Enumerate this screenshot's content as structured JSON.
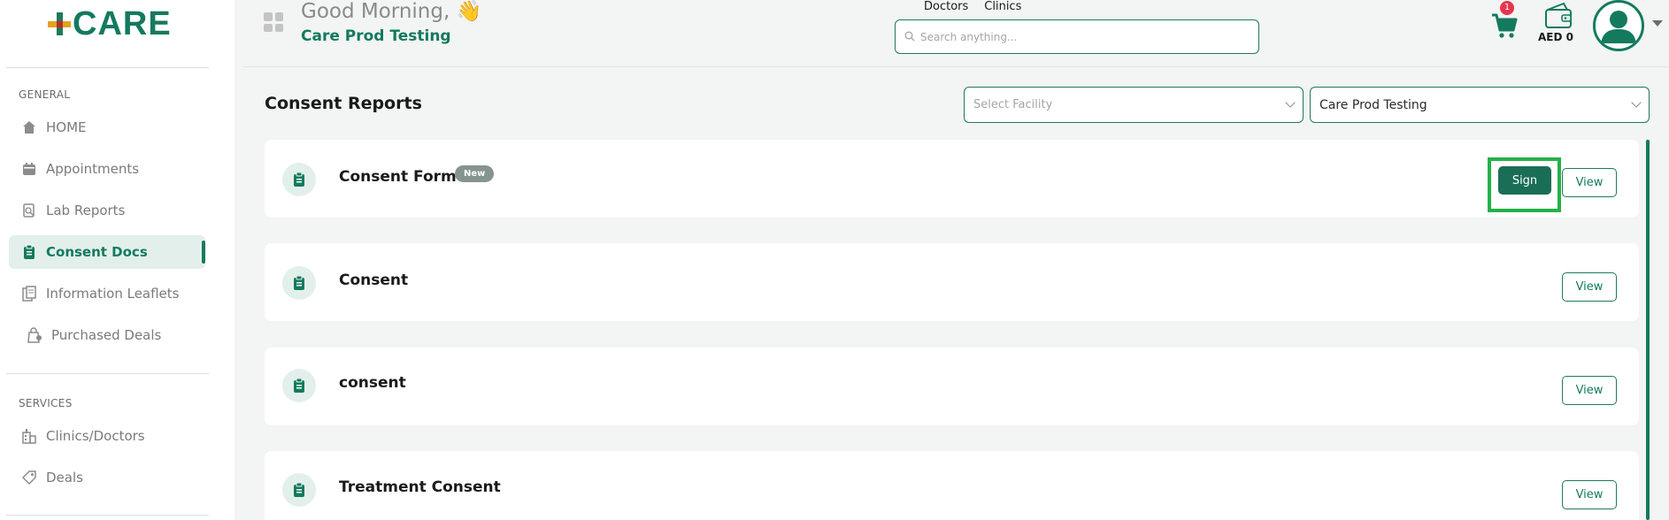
{
  "brand": {
    "logo_text": "CARE",
    "accent": "#137a5e"
  },
  "sidebar": {
    "sections": [
      {
        "label": "GENERAL"
      },
      {
        "label": "SERVICES"
      }
    ],
    "items": [
      {
        "label": "HOME",
        "icon": "home-icon"
      },
      {
        "label": "Appointments",
        "icon": "calendar-icon"
      },
      {
        "label": "Lab Reports",
        "icon": "lab-icon"
      },
      {
        "label": "Consent Docs",
        "icon": "clipboard-icon",
        "active": true
      },
      {
        "label": "Information Leaflets",
        "icon": "leaflet-icon"
      },
      {
        "label": "Purchased Deals",
        "icon": "deal-bag-icon"
      },
      {
        "label": "Clinics/Doctors",
        "icon": "building-icon"
      },
      {
        "label": "Deals",
        "icon": "tag-icon"
      }
    ]
  },
  "header": {
    "greeting": "Good Morning, 👋",
    "org_name": "Care Prod Testing",
    "tabs": [
      "Doctors",
      "Clinics"
    ],
    "search_placeholder": "Search anything...",
    "cart_count": "1",
    "wallet": "AED 0"
  },
  "main": {
    "title": "Consent Reports",
    "facility_placeholder": "Select Facility",
    "org_select": "Care Prod Testing",
    "cards": [
      {
        "title": "Consent Form",
        "badge": "New",
        "sign_label": "Sign",
        "view_label": "View"
      },
      {
        "title": "Consent",
        "view_label": "View"
      },
      {
        "title": "consent",
        "view_label": "View"
      },
      {
        "title": "Treatment Consent",
        "view_label": "View"
      }
    ]
  }
}
